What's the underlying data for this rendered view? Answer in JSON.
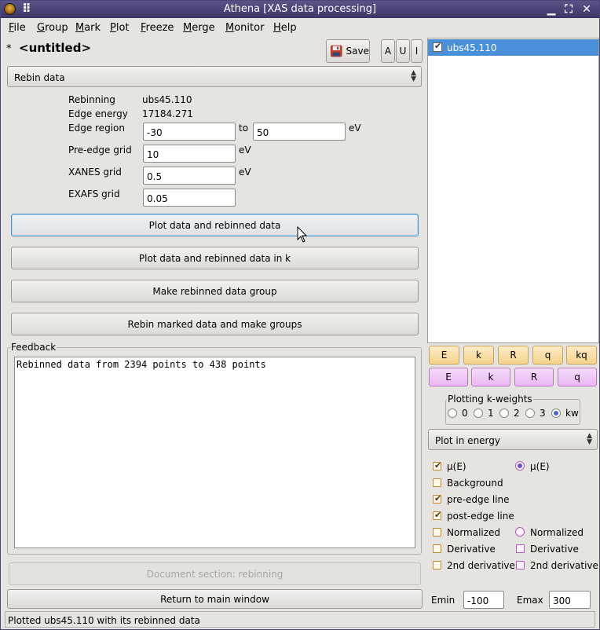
{
  "window": {
    "title": "Athena [XAS data processing]"
  },
  "menubar": {
    "items": [
      {
        "u": "F",
        "rest": "ile"
      },
      {
        "u": "G",
        "rest": "roup"
      },
      {
        "u": "M",
        "rest": "ark"
      },
      {
        "u": "P",
        "rest": "lot"
      },
      {
        "u": "F",
        "rest": "reeze"
      },
      {
        "u": "M",
        "rest": "erge"
      },
      {
        "u": "M",
        "rest": "onitor"
      },
      {
        "u": "H",
        "rest": "elp"
      }
    ]
  },
  "header": {
    "modified_marker": "*",
    "project_name": "<untitled>",
    "save_label": "Save",
    "a_label": "A",
    "u_label": "U",
    "i_label": "I"
  },
  "tool_select": {
    "value": "Rebin data"
  },
  "rebin": {
    "rebinning_label": "Rebinning",
    "rebinning_value": "ubs45.110",
    "edge_energy_label": "Edge energy",
    "edge_energy_value": "17184.271",
    "edge_region_label": "Edge region",
    "edge_region_from": "-30",
    "to_label": "to",
    "edge_region_to": "50",
    "ev_unit": "eV",
    "pre_edge_label": "Pre-edge grid",
    "pre_edge_value": "10",
    "xanes_label": "XANES grid",
    "xanes_value": "0.5",
    "exafs_label": "EXAFS grid",
    "exafs_value": "0.05"
  },
  "actions": {
    "plot_rebinned": "Plot data and rebinned data",
    "plot_rebinned_k": "Plot data and rebinned data in k",
    "make_group": "Make rebinned data group",
    "rebin_marked": "Rebin marked data and make groups"
  },
  "feedback": {
    "legend": "Feedback",
    "text": "Rebinned data from 2394 points to 438 points"
  },
  "bottom": {
    "document_label": "Document section: rebinning",
    "return_label": "Return to main window"
  },
  "status": {
    "text": "Plotted ubs45.110 with its rebinned data"
  },
  "groups": [
    {
      "name": "ubs45.110",
      "checked": true
    }
  ],
  "plot_buttons": {
    "single": [
      "E",
      "k",
      "R",
      "q",
      "kq"
    ],
    "marked": [
      "E",
      "k",
      "R",
      "q"
    ]
  },
  "kweights": {
    "legend": "Plotting k-weights",
    "options": [
      "0",
      "1",
      "2",
      "3",
      "kw"
    ],
    "selected": "kw"
  },
  "plot_space": {
    "value": "Plot in energy"
  },
  "plot_options": {
    "left": [
      {
        "label": "μ(E)",
        "checked": true
      },
      {
        "label": "Background",
        "checked": false
      },
      {
        "label": "pre-edge line",
        "checked": true
      },
      {
        "label": "post-edge line",
        "checked": true
      },
      {
        "label": "Normalized",
        "checked": false
      },
      {
        "label": "Derivative",
        "checked": false
      },
      {
        "label": "2nd derivative",
        "checked": false
      }
    ],
    "right": [
      {
        "label": "μ(E)",
        "kind": "radio",
        "selected": true
      },
      {
        "label": "Normalized",
        "kind": "radio",
        "selected": false
      },
      {
        "label": "Derivative",
        "kind": "check",
        "checked": false
      },
      {
        "label": "2nd derivative",
        "kind": "check",
        "checked": false
      }
    ]
  },
  "range": {
    "emin_label": "Emin",
    "emin_value": "-100",
    "emax_label": "Emax",
    "emax_value": "300"
  },
  "colors": {
    "titlebar": "#4a4378",
    "selection": "#4a90d9",
    "orange_button": "#f7d796",
    "purple_button": "#efc2f6"
  }
}
